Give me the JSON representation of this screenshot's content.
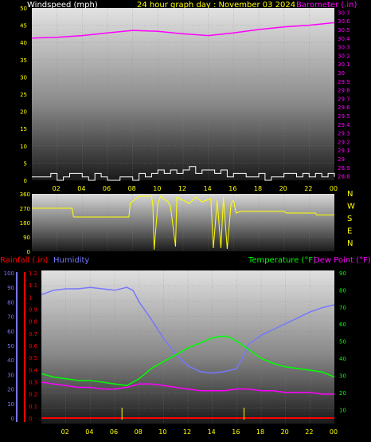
{
  "colors": {
    "background": "#000000",
    "wind_text": "#ffffff",
    "title_text": "#ffff00",
    "barometer": "#ff00ff",
    "direction": "#ffff00",
    "rainfall": "#ff0000",
    "humidity": "#7777ff",
    "temperature": "#00ff00",
    "dewpoint": "#ff00ff",
    "tick_text": "#ffff00",
    "grid": "#888888"
  },
  "labels": {
    "windspeed": "Windspeed (mph)",
    "title": "24 hour graph day : November 03 2024",
    "barometer": "Barometer (.in)",
    "rainfall": "Rainfall (.in)",
    "humidity": "Humidity",
    "temperature": "Temperature (°F)",
    "dewpoint": "Dew Point (°F)",
    "compass": [
      "N",
      "W",
      "S",
      "E",
      "N"
    ]
  },
  "chart_data": [
    {
      "type": "line",
      "x_ticks": [
        "02",
        "04",
        "06",
        "08",
        "10",
        "12",
        "14",
        "16",
        "18",
        "20",
        "22",
        "00"
      ],
      "wind_ticks": [
        "50",
        "45",
        "40",
        "35",
        "30",
        "25",
        "20",
        "15",
        "10",
        "5",
        "0"
      ],
      "baro_ticks": [
        "30.7",
        "30.6",
        "30.5",
        "30.4",
        "30.3",
        "30.2",
        "30.1",
        "30",
        "29.9",
        "29.8",
        "29.7",
        "29.6",
        "29.5",
        "29.4",
        "29.3",
        "29.2",
        "29.1",
        "29",
        "28.9",
        "28.8"
      ],
      "ylim_wind": [
        0,
        50
      ],
      "ylim_baro": [
        28.75,
        30.75
      ],
      "xlim_hours": [
        0,
        24
      ],
      "series": [
        {
          "name": "Barometer (.in)",
          "hours": [
            0,
            2,
            4,
            6,
            8,
            10,
            12,
            14,
            16,
            18,
            20,
            22,
            24
          ],
          "values": [
            30.4,
            30.41,
            30.43,
            30.46,
            30.49,
            30.48,
            30.45,
            30.43,
            30.46,
            30.5,
            30.53,
            30.55,
            30.58
          ]
        },
        {
          "name": "Windspeed (mph)",
          "hours": [
            0,
            1,
            1.5,
            2,
            2.5,
            3,
            4,
            4.5,
            5,
            5.5,
            6,
            7,
            8,
            8.5,
            9,
            9.5,
            10,
            10.5,
            11,
            11.5,
            12,
            12.5,
            13,
            13.5,
            14,
            14.5,
            15,
            15.5,
            16,
            17,
            18,
            18.5,
            19,
            20,
            21,
            21.5,
            22,
            22.5,
            23,
            23.5,
            24
          ],
          "values": [
            1,
            1,
            2,
            0,
            1,
            2,
            1,
            0,
            2,
            1,
            0,
            1,
            0,
            2,
            1,
            2,
            3,
            2,
            3,
            2,
            3,
            4,
            2,
            3,
            3,
            2,
            3,
            1,
            2,
            1,
            2,
            0,
            1,
            2,
            1,
            2,
            1,
            2,
            1,
            2,
            1
          ]
        }
      ]
    },
    {
      "type": "line",
      "x_ticks": [
        "02",
        "04",
        "06",
        "08",
        "10",
        "12",
        "14",
        "16",
        "18",
        "20",
        "22",
        "00"
      ],
      "y_ticks": [
        "360",
        "270",
        "180",
        "90",
        "0"
      ],
      "ylim": [
        0,
        360
      ],
      "series": [
        {
          "name": "Wind Direction",
          "hours": [
            0,
            3.2,
            3.3,
            7.7,
            7.8,
            8.5,
            9.5,
            9.6,
            9.7,
            10,
            10.2,
            10.8,
            11,
            11.4,
            11.5,
            12,
            12.5,
            13,
            13.5,
            14.2,
            14.4,
            14.7,
            15,
            15.2,
            15.5,
            15.8,
            16,
            16.2,
            16.6,
            20,
            20.2,
            22.5,
            22.6,
            24
          ],
          "values": [
            270,
            270,
            215,
            215,
            300,
            345,
            345,
            290,
            10,
            300,
            345,
            310,
            280,
            30,
            340,
            320,
            300,
            340,
            310,
            330,
            20,
            320,
            20,
            340,
            15,
            300,
            320,
            240,
            250,
            250,
            240,
            240,
            228,
            228
          ]
        }
      ]
    },
    {
      "type": "line",
      "x_ticks": [
        "02",
        "04",
        "06",
        "08",
        "10",
        "12",
        "14",
        "16",
        "18",
        "20",
        "22",
        "00"
      ],
      "humidity_ticks": [
        "100",
        "90",
        "80",
        "70",
        "60",
        "50",
        "40",
        "30",
        "20",
        "10",
        "0"
      ],
      "rain_ticks": [
        "1.2",
        "1.1",
        "1",
        "0.9",
        "0.8",
        "0.7",
        "0.6",
        "0.5",
        "0.4",
        "0.3",
        "0.2",
        "0.1",
        "0"
      ],
      "temp_ticks": [
        "90",
        "80",
        "70",
        "60",
        "50",
        "40",
        "30",
        "20",
        "10"
      ],
      "ylim_humidity": [
        0,
        100
      ],
      "ylim_rain": [
        0,
        1.2
      ],
      "ylim_temp": [
        5,
        90
      ],
      "series": [
        {
          "name": "Humidity",
          "hours": [
            0,
            1,
            2,
            3,
            4,
            5,
            6,
            7,
            7.5,
            8,
            9,
            10,
            11,
            12,
            12.5,
            13,
            14,
            15,
            16,
            16.5,
            17,
            18,
            19,
            20,
            21,
            22,
            23,
            24
          ],
          "values": [
            85,
            88,
            89,
            89,
            90,
            89,
            88,
            90,
            88,
            80,
            68,
            55,
            44,
            36,
            34,
            32,
            31,
            32,
            34,
            42,
            51,
            57,
            61,
            65,
            69,
            73,
            76,
            78
          ]
        },
        {
          "name": "Temperature (°F)",
          "hours": [
            0,
            1,
            2,
            3,
            4,
            5,
            6,
            7,
            8,
            9,
            10,
            11,
            12,
            13,
            14,
            15,
            15.5,
            16,
            17,
            18,
            19,
            20,
            21,
            22,
            23,
            24
          ],
          "values": [
            31,
            29,
            28,
            27,
            27,
            26,
            25,
            24,
            28,
            34,
            38,
            42,
            46,
            49,
            52,
            53,
            52,
            50,
            45,
            40,
            37,
            35,
            34,
            33,
            32,
            29
          ]
        },
        {
          "name": "Dew Point (°F)",
          "hours": [
            0,
            1,
            2,
            3,
            4,
            5,
            6,
            7,
            8,
            9,
            10,
            11,
            12,
            13,
            14,
            15,
            16,
            17,
            18,
            19,
            20,
            21,
            22,
            23,
            24
          ],
          "values": [
            26,
            25,
            24,
            23,
            23,
            22,
            22,
            23,
            25,
            25,
            24,
            23,
            22,
            21,
            21,
            21,
            22,
            22,
            21,
            21,
            20,
            20,
            20,
            19,
            19
          ]
        },
        {
          "name": "Rainfall (.in)",
          "hours": [
            0,
            24
          ],
          "values": [
            0,
            0
          ]
        }
      ],
      "rain_markers_hours": [
        6.6,
        16.6
      ]
    }
  ]
}
